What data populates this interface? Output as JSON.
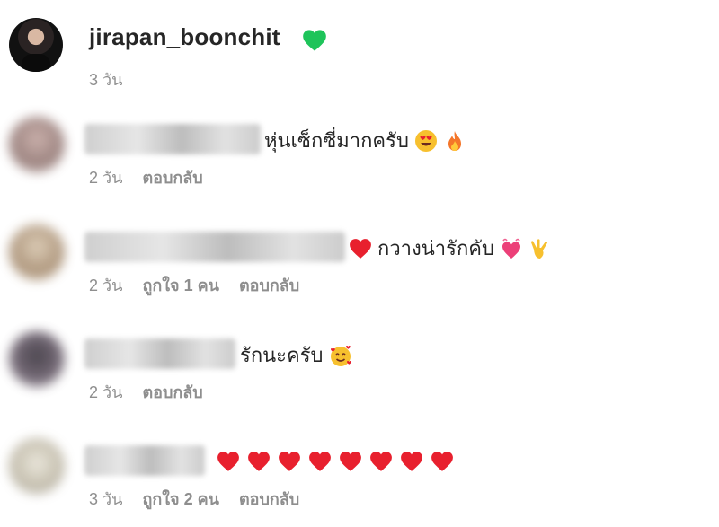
{
  "post": {
    "username": "jirapan_boonchit",
    "time": "3 วัน"
  },
  "comments": [
    {
      "text": "หุ่นเซ็กซี่มากครับ",
      "time": "2 วัน",
      "likes": "",
      "reply": "ตอบกลับ",
      "avatar_color": "#9a7f7a",
      "emojis": [
        "smiling-face-heart-eyes-icon",
        "fire-icon"
      ]
    },
    {
      "text": "กวางน่ารักคับ",
      "time": "2 วัน",
      "likes": "ถูกใจ 1 คน",
      "reply": "ตอบกลับ",
      "avatar_color": "#a58e75",
      "emojis": [
        "red-heart-icon",
        "beating-heart-icon",
        "love-you-gesture-icon"
      ]
    },
    {
      "text": "รักนะครับ",
      "time": "2 วัน",
      "likes": "",
      "reply": "ตอบกลับ",
      "avatar_color": "#4b3f4a",
      "emojis": [
        "smiling-face-with-hearts-icon"
      ]
    },
    {
      "text": "",
      "time": "3 วัน",
      "likes": "ถูกใจ 2 คน",
      "reply": "ตอบกลับ",
      "avatar_color": "#cfc9b9",
      "emojis": [
        "red-heart-icon",
        "red-heart-icon",
        "red-heart-icon",
        "red-heart-icon",
        "red-heart-icon",
        "red-heart-icon",
        "red-heart-icon",
        "red-heart-icon"
      ]
    }
  ],
  "colors": {
    "text": "#262626",
    "secondary": "#8e8e8e",
    "verified_heart": "#1ec45a",
    "heart_red": "#e8202e"
  }
}
